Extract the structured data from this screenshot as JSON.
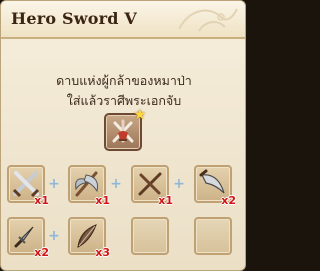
{
  "window": {
    "title": "Hero Sword V",
    "description_line1": "ดาบแห่งผู้กล้าของหมาป่า",
    "description_line2": "ใส่แล้วราศีพระเอกจับ"
  },
  "result_item": {
    "icon": "hero-sword-bundle-icon",
    "badge_icon": "star-icon",
    "badge_color": "#ffd83d"
  },
  "ingredients": [
    {
      "icon": "crossed-swords-icon",
      "qty": "x1"
    },
    {
      "icon": "battle-axe-icon",
      "qty": "x1"
    },
    {
      "icon": "crossed-sticks-icon",
      "qty": "x1"
    },
    {
      "icon": "curved-blade-icon",
      "qty": "x2"
    },
    {
      "icon": "dagger-icon",
      "qty": "x2"
    },
    {
      "icon": "feather-icon",
      "qty": "x3"
    },
    {
      "icon": "empty-slot"
    },
    {
      "icon": "empty-slot"
    }
  ],
  "plus_symbol": "+",
  "colors": {
    "quantity_text": "#d21414",
    "plus_sign": "#8fb8d8",
    "title_text": "#3a2412"
  }
}
